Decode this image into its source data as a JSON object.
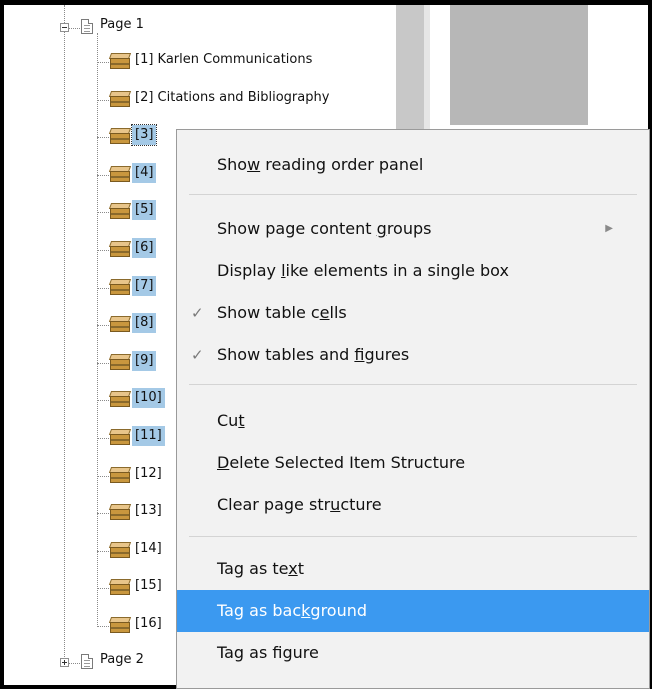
{
  "tree": {
    "pages": [
      {
        "label": "Page 1",
        "expanded": true
      },
      {
        "label": "Page 2",
        "expanded": false
      }
    ],
    "items": [
      {
        "label": "[1]  Karlen Communications",
        "selected": false
      },
      {
        "label": "[2]  Citations and Bibliography",
        "selected": false
      },
      {
        "label": "[3]",
        "selected": true,
        "focused": true
      },
      {
        "label": "[4]",
        "selected": true
      },
      {
        "label": "[5]",
        "selected": true
      },
      {
        "label": "[6]",
        "selected": true
      },
      {
        "label": "[7]",
        "selected": true
      },
      {
        "label": "[8]",
        "selected": true
      },
      {
        "label": "[9]",
        "selected": true
      },
      {
        "label": "[10]",
        "selected": true
      },
      {
        "label": "[11]",
        "selected": true
      },
      {
        "label": "[12]",
        "selected": false
      },
      {
        "label": "[13]",
        "selected": false
      },
      {
        "label": "[14]",
        "selected": false
      },
      {
        "label": "[15]",
        "selected": false
      },
      {
        "label": "[16]",
        "selected": false
      }
    ]
  },
  "menu": {
    "items": [
      {
        "pre": "Sho",
        "key": "w",
        "post": " reading order panel"
      },
      {
        "pre": "Show page content ",
        "key": "g",
        "post": "roups",
        "submenu": true
      },
      {
        "pre": "Display ",
        "key": "l",
        "post": "ike elements in a single box"
      },
      {
        "pre": "Show table c",
        "key": "e",
        "post": "lls",
        "checked": true
      },
      {
        "pre": "Show tables and ",
        "key": "f",
        "post": "igures",
        "checked": true
      },
      {
        "pre": "Cu",
        "key": "t",
        "post": ""
      },
      {
        "pre": "",
        "key": "D",
        "post": "elete Selected Item Structure"
      },
      {
        "pre": "Clear page str",
        "key": "u",
        "post": "cture"
      },
      {
        "pre": "Tag as te",
        "key": "x",
        "post": "t"
      },
      {
        "pre": "Tag as bac",
        "key": "k",
        "post": "ground",
        "highlighted": true
      },
      {
        "pre": "Tag as f",
        "key": "i",
        "post": "gure"
      }
    ],
    "check_glyph": "✓",
    "submenu_glyph": "▶"
  },
  "colors": {
    "selection": "#a4c9e6",
    "highlight": "#3b99f0"
  }
}
